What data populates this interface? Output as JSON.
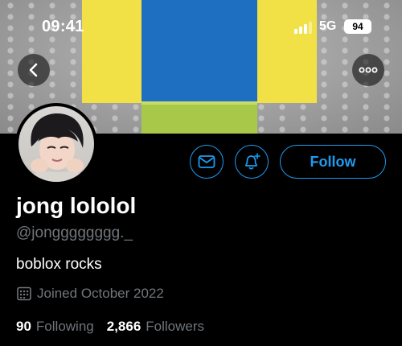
{
  "status_bar": {
    "time": "09:41",
    "network": "5G",
    "battery": "94"
  },
  "icons": {
    "back": "chevron-left-icon",
    "more": "ellipsis-icon",
    "mail": "mail-icon",
    "notify": "bell-plus-icon",
    "calendar": "calendar-icon"
  },
  "colors": {
    "accent": "#1d9bf0",
    "muted": "#71767b",
    "background": "#000000"
  },
  "profile": {
    "display_name": "jong lololol",
    "handle": "@jongggggggg._",
    "bio": "boblox rocks",
    "joined": "Joined October 2022",
    "following_count": "90",
    "following_label": "Following",
    "followers_count": "2,866",
    "followers_label": "Followers"
  },
  "actions": {
    "follow_label": "Follow"
  }
}
